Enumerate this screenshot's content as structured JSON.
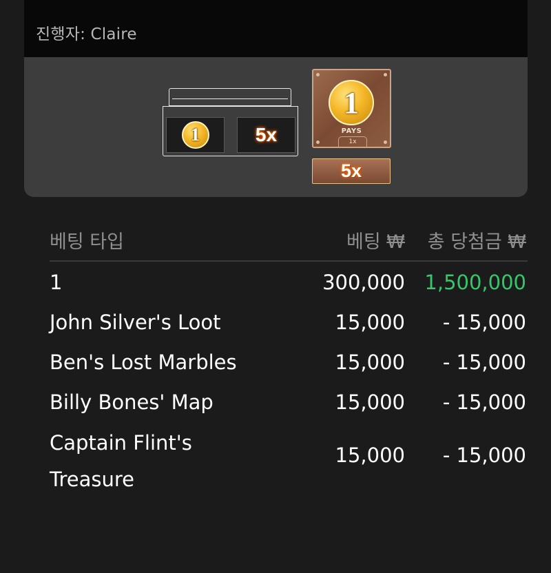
{
  "header": {
    "presenter": "진행자: Claire"
  },
  "result": {
    "chest_coin": "1",
    "chest_multiplier": "5x",
    "card_coin": "1",
    "card_pays": "PAYS",
    "card_pays_multiplier": "1x",
    "bonus_multiplier": "5x"
  },
  "table": {
    "col_type": "베팅 타입",
    "col_bet": "베팅 ₩",
    "col_win": "총 당첨금 ₩",
    "rows": [
      {
        "name": "1",
        "bet": "300,000",
        "win": "1,500,000"
      },
      {
        "name": "John Silver's Loot",
        "bet": "15,000",
        "win": "- 15,000"
      },
      {
        "name": "Ben's Lost Marbles",
        "bet": "15,000",
        "win": "- 15,000"
      },
      {
        "name": "Billy Bones' Map",
        "bet": "15,000",
        "win": "- 15,000"
      },
      {
        "name_line1": "Captain Flint's",
        "name_line2": "Treasure",
        "bet": "15,000",
        "win": "- 15,000"
      }
    ]
  },
  "colors": {
    "background": "#1b1b1b",
    "header_bg": "#080808",
    "panel_bg": "#3d3d3d",
    "win_positive": "#35c76a",
    "muted_text": "#8f8f8f"
  },
  "icons": [
    "treasure-chest-icon",
    "gold-coin-icon",
    "pays-card-icon"
  ]
}
